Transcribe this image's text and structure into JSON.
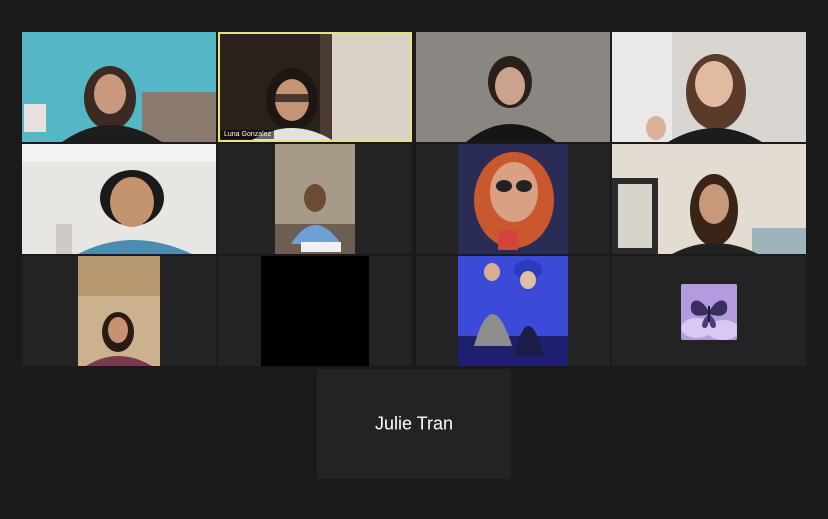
{
  "meeting": {
    "view": "gallery",
    "participants": [
      {
        "id": 1,
        "name": "",
        "camera": "on"
      },
      {
        "id": 2,
        "name": "Luna Gonzalez",
        "camera": "on",
        "active_speaker": true
      },
      {
        "id": 3,
        "name": "",
        "camera": "on"
      },
      {
        "id": 4,
        "name": "",
        "camera": "on"
      },
      {
        "id": 5,
        "name": "",
        "camera": "on"
      },
      {
        "id": 6,
        "name": "",
        "camera": "on"
      },
      {
        "id": 7,
        "name": "",
        "camera": "on"
      },
      {
        "id": 8,
        "name": "",
        "camera": "on"
      },
      {
        "id": 9,
        "name": "",
        "camera": "on"
      },
      {
        "id": 10,
        "name": "",
        "camera": "on"
      },
      {
        "id": 11,
        "name": "",
        "camera": "on"
      },
      {
        "id": 12,
        "name": "",
        "camera": "off",
        "avatar": "butterfly-icon"
      },
      {
        "id": 13,
        "name": "Julie Tran",
        "camera": "off"
      }
    ]
  },
  "colors": {
    "background": "#1a1a1a",
    "tile": "#232323",
    "active_border": "#e8e27a"
  }
}
